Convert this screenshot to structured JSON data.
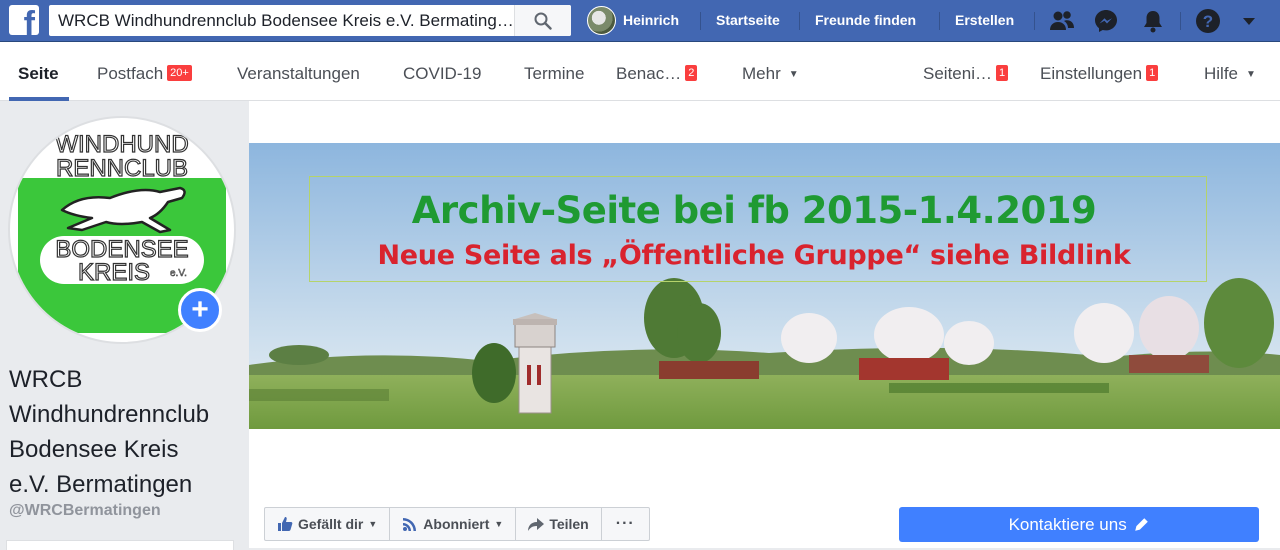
{
  "topbar": {
    "search_value": "WRCB Windhundrennclub Bodensee Kreis e.V. Bermatingen",
    "user_name": "Heinrich",
    "links": [
      "Startseite",
      "Freunde finden",
      "Erstellen"
    ]
  },
  "pagenav": {
    "items": [
      {
        "label": "Seite",
        "badge": ""
      },
      {
        "label": "Postfach",
        "badge": "20+"
      },
      {
        "label": "Veranstaltungen",
        "badge": ""
      },
      {
        "label": "COVID-19",
        "badge": ""
      },
      {
        "label": "Termine",
        "badge": ""
      },
      {
        "label": "Benac…",
        "badge": "2"
      },
      {
        "label": "Mehr",
        "badge": ""
      },
      {
        "label": "Seiteni…",
        "badge": "1"
      },
      {
        "label": "Einstellungen",
        "badge": "1"
      },
      {
        "label": "Hilfe",
        "badge": ""
      }
    ]
  },
  "profile": {
    "name_lines": [
      "WRCB",
      "Windhundrennclub",
      "Bodensee Kreis",
      "e.V. Bermatingen"
    ],
    "handle": "@WRCBermatingen",
    "logo_text": [
      "WINDHUND",
      "RENNCLUB",
      "BODENSEE",
      "KREIS",
      "e.V."
    ]
  },
  "cover": {
    "line1": "Archiv-Seite bei fb 2015-1.4.2019",
    "line2": "Neue Seite als „Öffentliche Gruppe“ siehe Bildlink"
  },
  "actions": {
    "like": "Gefällt dir",
    "follow": "Abonniert",
    "share": "Teilen",
    "more": "···",
    "contact": "Kontaktiere uns"
  },
  "colors": {
    "brand_blue": "#4267b2",
    "button_blue": "#4080ff",
    "badge_red": "#fa3e3e",
    "cover_green": "#1f9a32",
    "cover_red": "#d9232e"
  }
}
